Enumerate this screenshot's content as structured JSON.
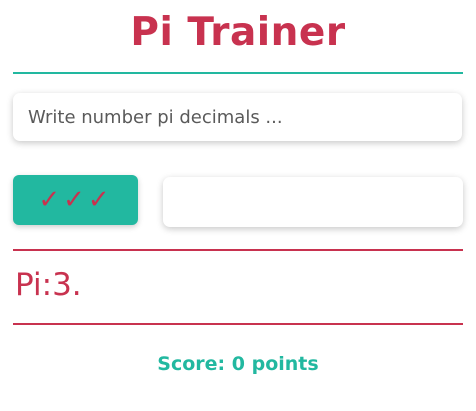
{
  "header": {
    "title": "Pi Trainer"
  },
  "input": {
    "placeholder": "Write number pi decimals ...",
    "value": ""
  },
  "check_button": {
    "label": "✓✓✓"
  },
  "result": {
    "text": ""
  },
  "pi_display": {
    "text": "Pi:3."
  },
  "score": {
    "text": "Score: 0 points"
  },
  "colors": {
    "title": "#c8324f",
    "accent_teal": "#22b8a0",
    "accent_pink": "#c8324f"
  }
}
